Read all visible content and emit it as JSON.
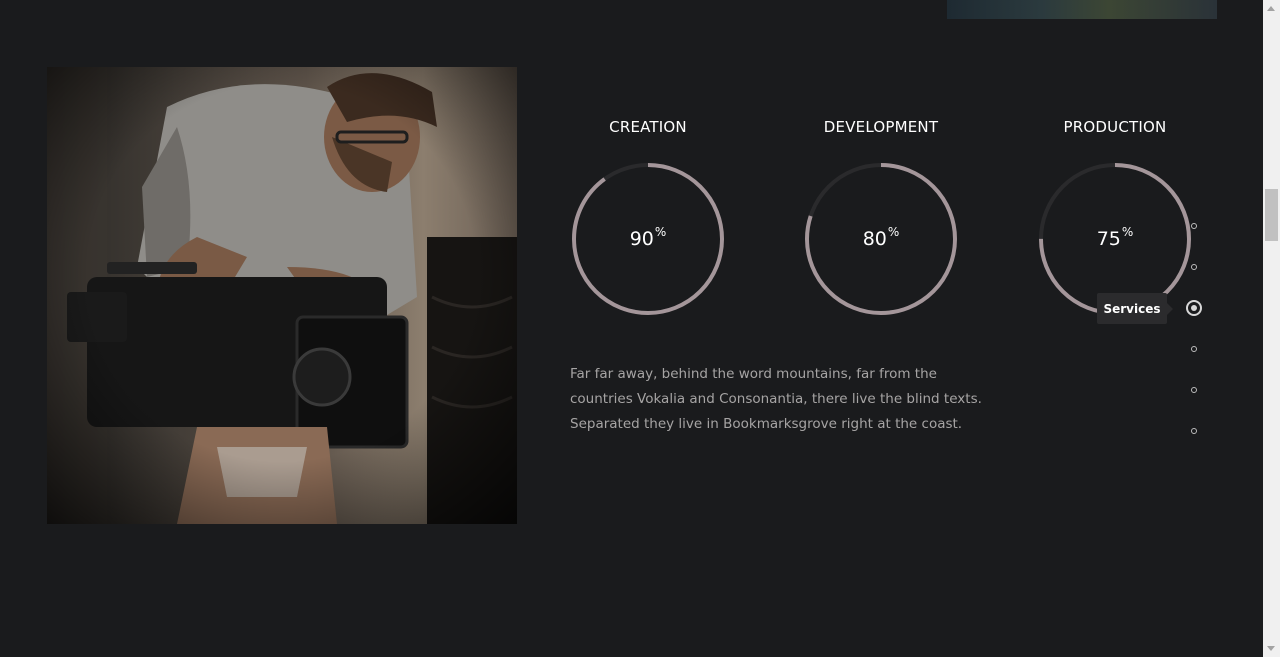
{
  "skills": [
    {
      "title": "CREATION",
      "value": 90,
      "unit": "%"
    },
    {
      "title": "DEVELOPMENT",
      "value": 80,
      "unit": "%"
    },
    {
      "title": "PRODUCTION",
      "value": 75,
      "unit": "%"
    }
  ],
  "description": "Far far away, behind the word mountains, far from the countries Vokalia and Consonantia, there live the blind texts. Separated they live in Bookmarksgrove right at the coast.",
  "dot_nav": {
    "active_index": 2,
    "tooltip": "Services",
    "count": 6
  },
  "colors": {
    "background": "#1a1b1d",
    "ring_progress": "#a4969a",
    "ring_track": "#2a2a2c",
    "text_muted": "#a6a4a4"
  },
  "icons": {
    "photo": "videographer-with-cinema-camera-image",
    "top_image": "landscape-image-fragment"
  }
}
